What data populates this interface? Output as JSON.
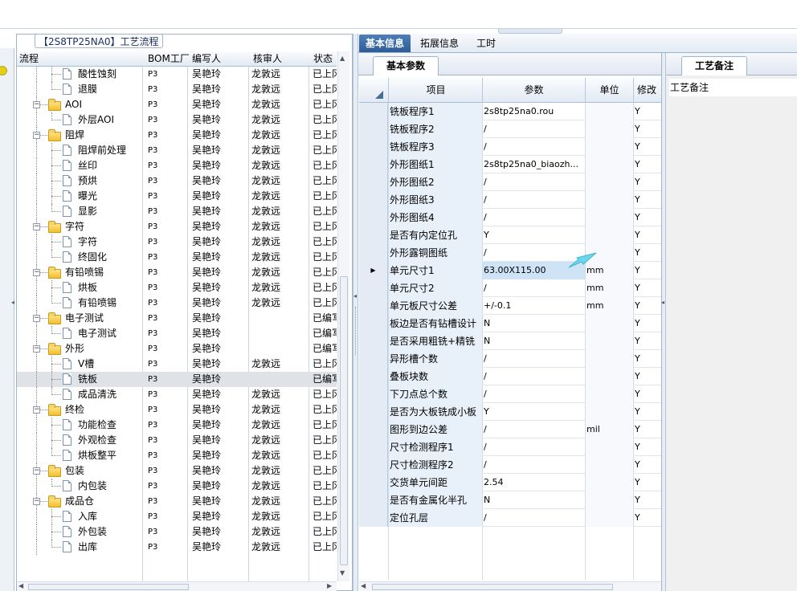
{
  "flow_panel": {
    "title": "【2S8TP25NA0】工艺流程",
    "columns": [
      "流程",
      "BOM工厂",
      "编写人",
      "核审人",
      "状态"
    ],
    "rows": [
      {
        "label": "酸性蚀刻",
        "type": "leaf",
        "bom": "P3",
        "writer": "吴艳玲",
        "reviewer": "龙敦远",
        "status": "已上冈",
        "last": false
      },
      {
        "label": "退膜",
        "type": "leaf",
        "bom": "P3",
        "writer": "吴艳玲",
        "reviewer": "龙敦远",
        "status": "已上冈",
        "last": true
      },
      {
        "label": "AOI",
        "type": "group",
        "bom": "P3",
        "writer": "吴艳玲",
        "reviewer": "龙敦远",
        "status": "已上冈"
      },
      {
        "label": "外层AOI",
        "type": "leaf",
        "bom": "P3",
        "writer": "吴艳玲",
        "reviewer": "龙敦远",
        "status": "已上冈",
        "last": true
      },
      {
        "label": "阻焊",
        "type": "group",
        "bom": "P3",
        "writer": "吴艳玲",
        "reviewer": "龙敦远",
        "status": "已上冈"
      },
      {
        "label": "阻焊前处理",
        "type": "leaf",
        "bom": "P3",
        "writer": "吴艳玲",
        "reviewer": "龙敦远",
        "status": "已上冈",
        "last": false
      },
      {
        "label": "丝印",
        "type": "leaf",
        "bom": "P3",
        "writer": "吴艳玲",
        "reviewer": "龙敦远",
        "status": "已上冈",
        "last": false
      },
      {
        "label": "预烘",
        "type": "leaf",
        "bom": "P3",
        "writer": "吴艳玲",
        "reviewer": "龙敦远",
        "status": "已上冈",
        "last": false
      },
      {
        "label": "曝光",
        "type": "leaf",
        "bom": "P3",
        "writer": "吴艳玲",
        "reviewer": "龙敦远",
        "status": "已上冈",
        "last": false
      },
      {
        "label": "显影",
        "type": "leaf",
        "bom": "P3",
        "writer": "吴艳玲",
        "reviewer": "龙敦远",
        "status": "已上冈",
        "last": true
      },
      {
        "label": "字符",
        "type": "group",
        "bom": "P3",
        "writer": "吴艳玲",
        "reviewer": "龙敦远",
        "status": "已上冈"
      },
      {
        "label": "字符",
        "type": "leaf",
        "bom": "P3",
        "writer": "吴艳玲",
        "reviewer": "龙敦远",
        "status": "已上冈",
        "last": false
      },
      {
        "label": "终固化",
        "type": "leaf",
        "bom": "P3",
        "writer": "吴艳玲",
        "reviewer": "龙敦远",
        "status": "已上冈",
        "last": true
      },
      {
        "label": "有铅喷锡",
        "type": "group",
        "bom": "P3",
        "writer": "吴艳玲",
        "reviewer": "龙敦远",
        "status": "已上冈"
      },
      {
        "label": "烘板",
        "type": "leaf",
        "bom": "P3",
        "writer": "吴艳玲",
        "reviewer": "龙敦远",
        "status": "已上冈",
        "last": false
      },
      {
        "label": "有铅喷锡",
        "type": "leaf",
        "bom": "P3",
        "writer": "吴艳玲",
        "reviewer": "龙敦远",
        "status": "已上冈",
        "last": true
      },
      {
        "label": "电子测试",
        "type": "group",
        "bom": "P3",
        "writer": "吴艳玲",
        "reviewer": "",
        "status": "已编写"
      },
      {
        "label": "电子测试",
        "type": "leaf",
        "bom": "P3",
        "writer": "吴艳玲",
        "reviewer": "",
        "status": "已编写",
        "last": true
      },
      {
        "label": "外形",
        "type": "group",
        "bom": "P3",
        "writer": "吴艳玲",
        "reviewer": "",
        "status": "已编写"
      },
      {
        "label": "V槽",
        "type": "leaf",
        "bom": "P3",
        "writer": "吴艳玲",
        "reviewer": "龙敦远",
        "status": "已上冈",
        "last": false
      },
      {
        "label": "铣板",
        "type": "leaf",
        "bom": "P3",
        "writer": "吴艳玲",
        "reviewer": "",
        "status": "已编写",
        "last": false,
        "selected": true
      },
      {
        "label": "成品清洗",
        "type": "leaf",
        "bom": "P3",
        "writer": "吴艳玲",
        "reviewer": "龙敦远",
        "status": "已上冈",
        "last": true
      },
      {
        "label": "终检",
        "type": "group",
        "bom": "P3",
        "writer": "吴艳玲",
        "reviewer": "龙敦远",
        "status": "已上冈"
      },
      {
        "label": "功能检查",
        "type": "leaf",
        "bom": "P3",
        "writer": "吴艳玲",
        "reviewer": "龙敦远",
        "status": "已上冈",
        "last": false
      },
      {
        "label": "外观检查",
        "type": "leaf",
        "bom": "P3",
        "writer": "吴艳玲",
        "reviewer": "龙敦远",
        "status": "已上冈",
        "last": false
      },
      {
        "label": "烘板整平",
        "type": "leaf",
        "bom": "P3",
        "writer": "吴艳玲",
        "reviewer": "龙敦远",
        "status": "已上冈",
        "last": true
      },
      {
        "label": "包装",
        "type": "group",
        "bom": "P3",
        "writer": "吴艳玲",
        "reviewer": "龙敦远",
        "status": "已上冈"
      },
      {
        "label": "内包装",
        "type": "leaf",
        "bom": "P3",
        "writer": "吴艳玲",
        "reviewer": "龙敦远",
        "status": "已上冈",
        "last": true
      },
      {
        "label": "成品仓",
        "type": "group",
        "bom": "P3",
        "writer": "吴艳玲",
        "reviewer": "龙敦远",
        "status": "已上冈"
      },
      {
        "label": "入库",
        "type": "leaf",
        "bom": "P3",
        "writer": "吴艳玲",
        "reviewer": "龙敦远",
        "status": "已上冈",
        "last": false
      },
      {
        "label": "外包装",
        "type": "leaf",
        "bom": "P3",
        "writer": "吴艳玲",
        "reviewer": "龙敦远",
        "status": "已上冈",
        "last": false
      },
      {
        "label": "出库",
        "type": "leaf",
        "bom": "P3",
        "writer": "吴艳玲",
        "reviewer": "龙敦远",
        "status": "已上冈",
        "last": true
      }
    ]
  },
  "detail_tabs": [
    "基本信息",
    "拓展信息",
    "工时"
  ],
  "basic_params": {
    "subtab": "基本参数",
    "columns": [
      "项目",
      "参数",
      "单位",
      "修改"
    ],
    "rows": [
      {
        "item": "铣板程序1",
        "value": "2s8tp25na0.rou",
        "unit": "",
        "mod": "Y"
      },
      {
        "item": "铣板程序2",
        "value": "/",
        "unit": "",
        "mod": "Y"
      },
      {
        "item": "铣板程序3",
        "value": "/",
        "unit": "",
        "mod": "Y"
      },
      {
        "item": "外形图纸1",
        "value": "2s8tp25na0_biaozh...",
        "unit": "",
        "mod": "Y"
      },
      {
        "item": "外形图纸2",
        "value": "/",
        "unit": "",
        "mod": "Y"
      },
      {
        "item": "外形图纸3",
        "value": "/",
        "unit": "",
        "mod": "Y"
      },
      {
        "item": "外形图纸4",
        "value": "/",
        "unit": "",
        "mod": "Y"
      },
      {
        "item": "是否有内定位孔",
        "value": "Y",
        "unit": "",
        "mod": "Y"
      },
      {
        "item": "外形露铜图纸",
        "value": "/",
        "unit": "",
        "mod": "Y"
      },
      {
        "item": "单元尺寸1",
        "value": "63.00X115.00",
        "unit": "mm",
        "mod": "Y",
        "current": true
      },
      {
        "item": "单元尺寸2",
        "value": "/",
        "unit": "mm",
        "mod": "Y"
      },
      {
        "item": "单元板尺寸公差",
        "value": "+/-0.1",
        "unit": "mm",
        "mod": "Y"
      },
      {
        "item": "板边是否有钻槽设计",
        "value": "N",
        "unit": "",
        "mod": "Y"
      },
      {
        "item": "是否采用粗铣+精铣",
        "value": "N",
        "unit": "",
        "mod": "Y"
      },
      {
        "item": "异形槽个数",
        "value": "/",
        "unit": "",
        "mod": "Y"
      },
      {
        "item": "叠板块数",
        "value": "/",
        "unit": "",
        "mod": "Y"
      },
      {
        "item": "下刀点总个数",
        "value": "/",
        "unit": "",
        "mod": "Y"
      },
      {
        "item": "是否为大板铣成小板",
        "value": "Y",
        "unit": "",
        "mod": "Y"
      },
      {
        "item": "图形到边公差",
        "value": "/",
        "unit": "mil",
        "mod": "Y"
      },
      {
        "item": "尺寸检测程序1",
        "value": "/",
        "unit": "",
        "mod": "Y"
      },
      {
        "item": "尺寸检测程序2",
        "value": "/",
        "unit": "",
        "mod": "Y"
      },
      {
        "item": "交货单元间距",
        "value": "2.54",
        "unit": "",
        "mod": "Y"
      },
      {
        "item": "是否有金属化半孔",
        "value": "N",
        "unit": "",
        "mod": "Y"
      },
      {
        "item": "定位孔层",
        "value": "/",
        "unit": "",
        "mod": "Y"
      }
    ]
  },
  "remarks": {
    "tab": "工艺备注",
    "label": "工艺备注"
  }
}
